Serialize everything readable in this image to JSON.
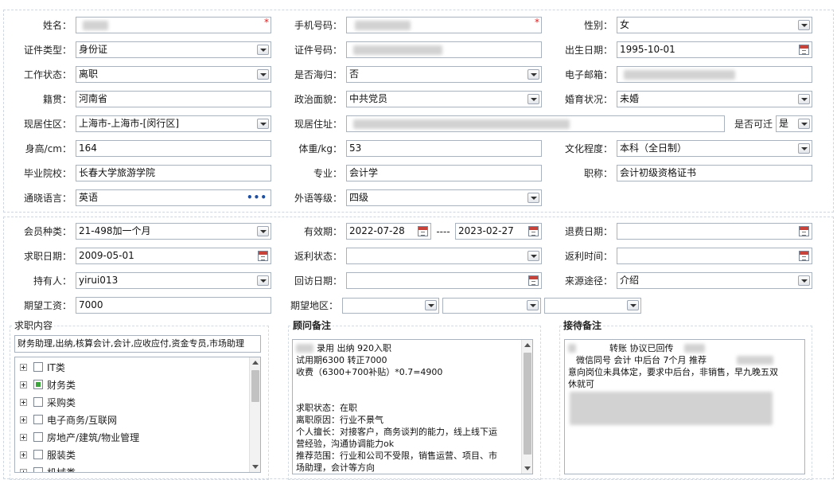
{
  "personal": {
    "name_label": "姓名：",
    "phone_label": "手机号码：",
    "gender_label": "性别：",
    "gender_value": "女",
    "id_type_label": "证件类型：",
    "id_type_value": "身份证",
    "id_number_label": "证件号码：",
    "birth_label": "出生日期：",
    "birth_value": "1995-10-01",
    "work_status_label": "工作状态：",
    "work_status_value": "离职",
    "overseas_label": "是否海归：",
    "overseas_value": "否",
    "email_label": "电子邮箱：",
    "native_label": "籍贯：",
    "native_value": "河南省",
    "political_label": "政治面貌：",
    "political_value": "中共党员",
    "marital_label": "婚育状况：",
    "marital_value": "未婚",
    "residence_area_label": "现居住区：",
    "residence_area_value": "上海市-上海市-[闵行区]",
    "residence_addr_label": "现居住址：",
    "relocate_label": "是否可迁",
    "relocate_value": "是",
    "height_label": "身高/cm：",
    "height_value": "164",
    "weight_label": "体重/kg：",
    "weight_value": "53",
    "education_label": "文化程度：",
    "education_value": "本科（全日制）",
    "school_label": "毕业院校：",
    "school_value": "长春大学旅游学院",
    "major_label": "专业：",
    "major_value": "会计学",
    "title_label": "职称：",
    "title_value": "会计初级资格证书",
    "language_label": "通晓语言：",
    "language_value": "英语",
    "lang_level_label": "外语等级：",
    "lang_level_value": "四级",
    "more_symbol": "•••",
    "required_mark": "*"
  },
  "membership": {
    "member_type_label": "会员种类：",
    "member_type_value": "21-498加一个月",
    "validity_label": "有效期：",
    "validity_start": "2022-07-28",
    "validity_sep": "----",
    "validity_end": "2023-02-27",
    "refund_date_label": "退费日期：",
    "job_date_label": "求职日期：",
    "job_date_value": "2009-05-01",
    "rebate_status_label": "返利状态：",
    "rebate_time_label": "返利时间：",
    "holder_label": "持有人：",
    "holder_value": "yirui013",
    "revisit_label": "回访日期：",
    "source_label": "来源途径：",
    "source_value": "介绍",
    "salary_label": "期望工资：",
    "salary_value": "7000",
    "region_label": "期望地区："
  },
  "job_content": {
    "title": "求职内容",
    "selected_text": "财务助理,出纳,核算会计,会计,应收应付,资金专员,市场助理",
    "tree": [
      {
        "label": "IT类",
        "state": "unchecked"
      },
      {
        "label": "财务类",
        "state": "partial"
      },
      {
        "label": "采购类",
        "state": "unchecked"
      },
      {
        "label": "电子商务/互联网",
        "state": "unchecked"
      },
      {
        "label": "房地产/建筑/物业管理",
        "state": "unchecked"
      },
      {
        "label": "服装类",
        "state": "unchecked"
      },
      {
        "label": "机械类",
        "state": "unchecked"
      }
    ]
  },
  "advisor_notes": {
    "title": "顾问备注",
    "lines": [
      "录用 出纳 920入职",
      "试用期6300 转正7000",
      "收费（6300+700补贴）*0.7=4900",
      "",
      "",
      "求职状态：在职",
      "离职原因：行业不景气",
      "个人擅长：对接客户，商务谈判的能力，线上线下运",
      "营经验，沟通协调能力ok",
      "推荐范围：行业和公司不受限，销售运营、项目、市",
      "场助理，会计等方向"
    ]
  },
  "reception_notes": {
    "title": "接待备注",
    "lines": [
      "转账 协议已回传",
      "微信同号 会计 中后台 7个月 推荐",
      "意向岗位未具体定，要求中后台，非销售，早九晚五双",
      "休就可"
    ]
  },
  "colors": {
    "border": "#a9b3c0",
    "dashed": "#cfd6e0",
    "required": "#e02020",
    "checked_green": "#3aa53a",
    "calendar_red": "#c8433a"
  }
}
